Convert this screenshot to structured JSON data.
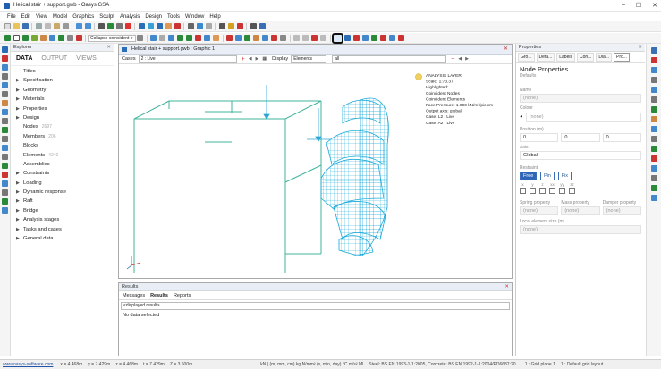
{
  "window": {
    "title": "Helical stair + support.gwb - Oasys GSA",
    "minimize": "–",
    "maximize": "☐",
    "close": "✕"
  },
  "menu": [
    "File",
    "Edit",
    "View",
    "Model",
    "Graphics",
    "Sculpt",
    "Analysis",
    "Design",
    "Tools",
    "Window",
    "Help"
  ],
  "toolbar": {
    "collapse_combo": "Collapse coincident e",
    "highlighted_tool": "section-profile-tool"
  },
  "explorer": {
    "title": "Explorer",
    "tabs": [
      "DATA",
      "OUTPUT",
      "VIEWS"
    ],
    "active_tab": "DATA",
    "items": [
      {
        "label": "Titles",
        "arrow": false,
        "count": ""
      },
      {
        "label": "Specification",
        "arrow": true,
        "count": ""
      },
      {
        "label": "Geometry",
        "arrow": true,
        "count": ""
      },
      {
        "label": "Materials",
        "arrow": true,
        "count": ""
      },
      {
        "label": "Properties",
        "arrow": true,
        "count": ""
      },
      {
        "label": "Design",
        "arrow": true,
        "count": ""
      },
      {
        "label": "Nodes",
        "arrow": false,
        "count": "2697"
      },
      {
        "label": "Members",
        "arrow": false,
        "count": "206"
      },
      {
        "label": "Blocks",
        "arrow": false,
        "count": ""
      },
      {
        "label": "Elements",
        "arrow": false,
        "count": "4240"
      },
      {
        "label": "Assemblies",
        "arrow": false,
        "count": ""
      },
      {
        "label": "Constraints",
        "arrow": true,
        "count": ""
      },
      {
        "label": "Loading",
        "arrow": true,
        "count": ""
      },
      {
        "label": "Dynamic response",
        "arrow": true,
        "count": ""
      },
      {
        "label": "Raft",
        "arrow": true,
        "count": ""
      },
      {
        "label": "Bridge",
        "arrow": true,
        "count": ""
      },
      {
        "label": "Analysis stages",
        "arrow": true,
        "count": ""
      },
      {
        "label": "Tasks and cases",
        "arrow": true,
        "count": ""
      },
      {
        "label": "General data",
        "arrow": true,
        "count": ""
      }
    ]
  },
  "graphic": {
    "title": "Helical stair + support.gwb : Graphic 1",
    "case_label": "Cases",
    "case_value": "2 : Live",
    "display_label": "Display",
    "display_value": "Elements",
    "list_value": "all",
    "analysis_layer": [
      "ANALYSIS LAYER",
      "Scale: 1:73.37",
      "Highlighted:",
      "Coincident Nodes",
      "Coincident Elements",
      "Face Pressure: 1.000 kN/m²/pic.cm",
      "  Output axis: global",
      "Case: L2 : Live",
      "Case: A2 : Live"
    ]
  },
  "properties": {
    "title": "Properties",
    "tabs": [
      "Gro...",
      "Defa...",
      "Labels",
      "Con...",
      "Dia...",
      "Pro..."
    ],
    "active_tab": "Pro...",
    "heading": "Node Properties",
    "subheading": "Defaults",
    "name_label": "Name",
    "name_value": "(none)",
    "colour_label": "Colour",
    "colour_value": "(none)",
    "position_label": "Position (m)",
    "position": [
      "0",
      "0",
      "0"
    ],
    "axis_label": "Axis",
    "axis_value": "Global",
    "restraint_label": "Restraint",
    "restraint_buttons": [
      "Free",
      "Pin",
      "Fix"
    ],
    "restraint_active": "Free",
    "dofs": [
      "x",
      "y",
      "z",
      "xx",
      "yy",
      "zz"
    ],
    "spring_label": "Spring property",
    "mass_label": "Mass property",
    "damper_label": "Damper property",
    "spring_value": "(none)",
    "mass_value": "(none)",
    "damper_value": "(none)",
    "mesh_label": "Local element size (m)",
    "mesh_value": "(none)"
  },
  "results": {
    "title": "Results",
    "tabs": [
      "Messages",
      "Results",
      "Reports"
    ],
    "active_tab": "Results",
    "combo": "<displayed result>",
    "message": "No data selected"
  },
  "status": {
    "link": "www.oasys-software.com",
    "coords": [
      "x = 4.468m",
      "y = 7.429m",
      "z = 4.468m",
      "t = 7.429m",
      "Z = 3.600m"
    ],
    "units": "kN | (m, mm, cm) kg  N/mm² (s, min, day) °C  m/s²  Ml",
    "codes": "Steel: BS EN 1993-1-1:2005, Concrete: BS EN 1992-1-1:2004/PD6687:20...",
    "grid_plane": "1 : Grid plane 1",
    "grid_layout": "1 : Default grid layout"
  },
  "colors": {
    "mesh": "#1aa9d8",
    "frame": "#3fb59b",
    "load_arrow": "#2aa6d4",
    "accent": "#2e67b8"
  }
}
